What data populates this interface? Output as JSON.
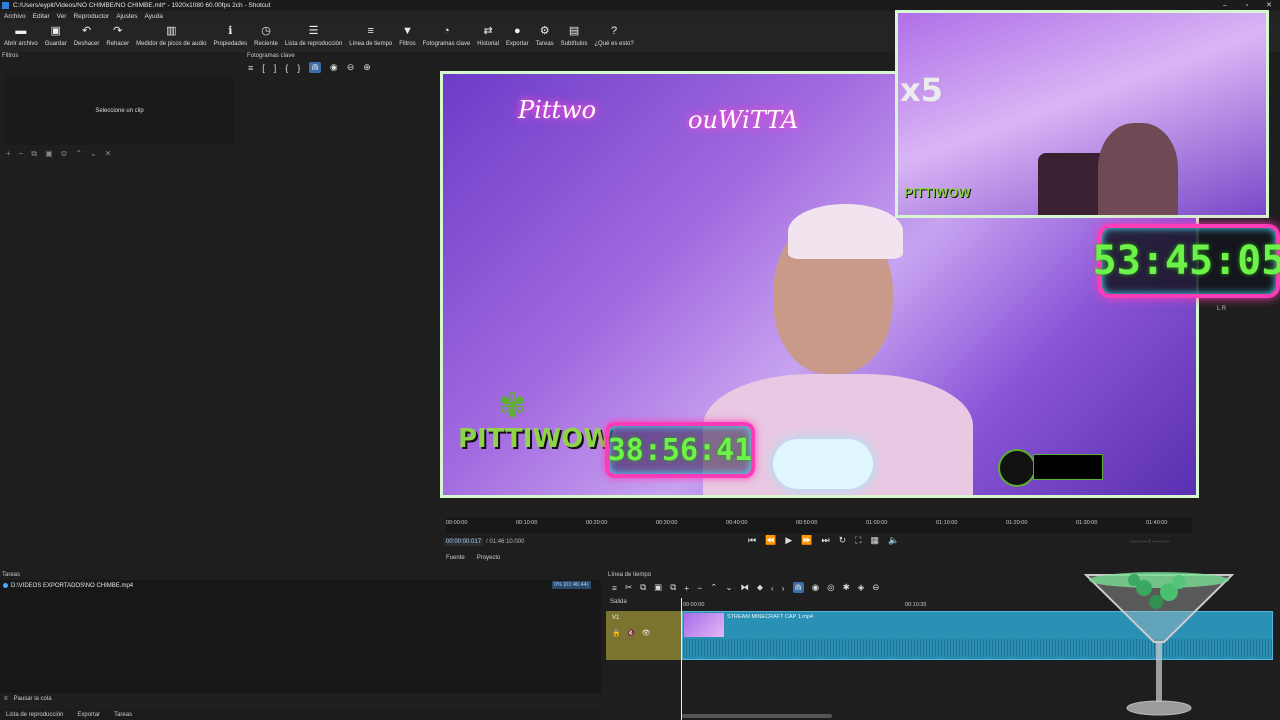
{
  "window": {
    "title": "C:/Users/eypit/Videos/NO CHIMBE/NO CHIMBE.mlt* - 1920x1080 60.00fps 2ch - Shotcut"
  },
  "menu": [
    "Archivo",
    "Editar",
    "Ver",
    "Reproductor",
    "Ajustes",
    "Ayuda"
  ],
  "toolbar": [
    {
      "icon": "folder-open-icon",
      "glyph": "▬",
      "label": "Abrir archivo"
    },
    {
      "icon": "save-icon",
      "glyph": "▣",
      "label": "Guardar"
    },
    {
      "icon": "undo-icon",
      "glyph": "↶",
      "label": "Deshacer"
    },
    {
      "icon": "redo-icon",
      "glyph": "↷",
      "label": "Rehacer"
    },
    {
      "icon": "audio-meter-icon",
      "glyph": "▥",
      "label": "Medidor de picos de audio"
    },
    {
      "icon": "info-icon",
      "glyph": "ℹ",
      "label": "Propiedades"
    },
    {
      "icon": "clock-icon",
      "glyph": "◷",
      "label": "Reciente"
    },
    {
      "icon": "playlist-icon",
      "glyph": "☰",
      "label": "Lista de reproducción"
    },
    {
      "icon": "timeline-icon",
      "glyph": "≡",
      "label": "Línea de tiempo"
    },
    {
      "icon": "filter-icon",
      "glyph": "▼",
      "label": "Filtros"
    },
    {
      "icon": "keyframes-icon",
      "glyph": "◔",
      "label": "Fotogramas clave"
    },
    {
      "icon": "history-icon",
      "glyph": "⇄",
      "label": "Historial"
    },
    {
      "icon": "export-icon",
      "glyph": "●",
      "label": "Exportar"
    },
    {
      "icon": "gear-icon",
      "glyph": "⚙",
      "label": "Tareas"
    },
    {
      "icon": "subtitles-icon",
      "glyph": "▤",
      "label": "Subtítulos"
    },
    {
      "icon": "question-icon",
      "glyph": "?",
      "label": "¿Qué es esto?"
    }
  ],
  "filters": {
    "title": "Filtros",
    "empty_message": "Seleccione un clip",
    "tools": [
      "+",
      "−",
      "⧉",
      "▣",
      "⊜",
      "⌃",
      "⌄",
      "✕"
    ]
  },
  "keyframes": {
    "title": "Fotogramas clave",
    "tools": [
      "≡",
      "[",
      "]",
      "{",
      "}",
      "⋒",
      "◉",
      "⊖",
      "⊕"
    ]
  },
  "overlay": {
    "neon_left": "Pittwo",
    "neon_right": "ouWiTTA",
    "brand": "PITTIWOW",
    "brand_small": "PITTIWOW",
    "stream_timer": "38:56:41",
    "big_timer": "53:45:05",
    "multiplier": "x5",
    "lr": "L R"
  },
  "player": {
    "ruler_ticks": [
      "00:00:00",
      "00:10:00",
      "00:20:00",
      "00:30:00",
      "00:40:00",
      "00:50:00",
      "01:00:00",
      "01:10:00",
      "01:20:00",
      "01:30:00",
      "01:40:00"
    ],
    "current_time": "00:00:00.017",
    "total_time": "/ 01:46:10.000",
    "tabs": [
      "Fuente",
      "Proyecto"
    ],
    "right_fields": "--:--:--:-- / --:--:--:--"
  },
  "tasks": {
    "title": "Tareas",
    "job_path": "D:\\VIDEOS EXPORTADOS\\NO CHIMBE.mp4",
    "job_progress": "0% (01:46:44)",
    "pause_label": "Pausar la cola"
  },
  "bottom_tabs": [
    "Lista de reproducción",
    "Exportar",
    "Tareas"
  ],
  "timeline": {
    "title": "Línea de tiempo",
    "output_label": "Salida",
    "track": "V1",
    "ticks": [
      "00:00:00",
      "00:10:35"
    ],
    "clip_name": "STREAM MINECRAFT CAP 1.mp4"
  }
}
